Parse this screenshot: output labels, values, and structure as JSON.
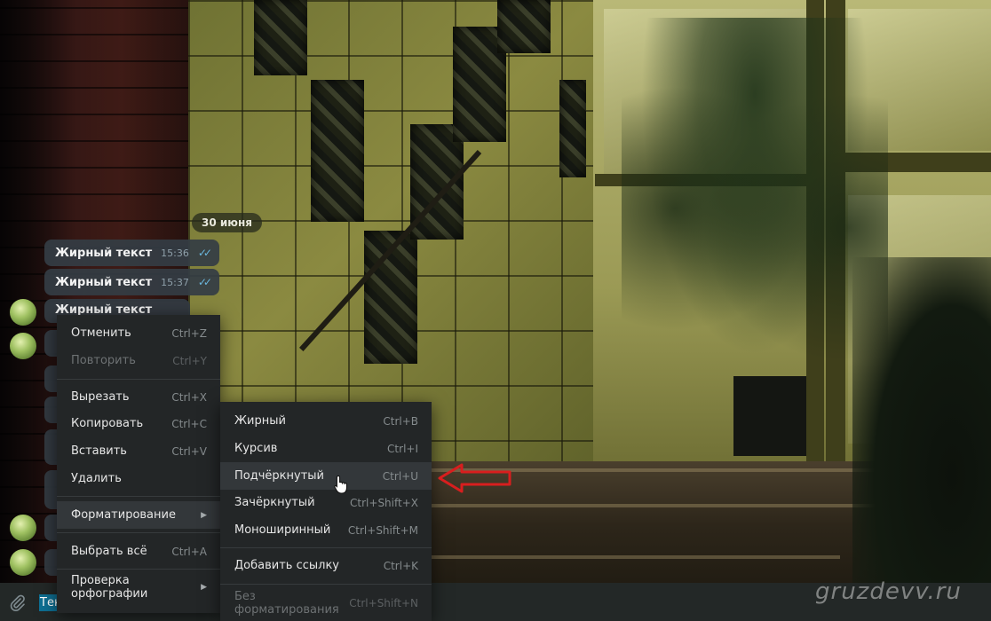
{
  "chat": {
    "date": "30 июня",
    "messages": [
      {
        "text": "Жирный текст",
        "time": "15:36",
        "status": "read"
      },
      {
        "text": "Жирный текст",
        "time": "15:37",
        "status": "read"
      },
      {
        "text": "Жирный текст"
      }
    ]
  },
  "input": {
    "text": "Тек"
  },
  "main_menu": {
    "items": [
      {
        "label": "Отменить",
        "shortcut": "Ctrl+Z"
      },
      {
        "label": "Повторить",
        "shortcut": "Ctrl+Y"
      },
      {
        "label": "Вырезать",
        "shortcut": "Ctrl+X"
      },
      {
        "label": "Копировать",
        "shortcut": "Ctrl+C"
      },
      {
        "label": "Вставить",
        "shortcut": "Ctrl+V"
      },
      {
        "label": "Удалить"
      },
      {
        "label": "Форматирование"
      },
      {
        "label": "Выбрать всё",
        "shortcut": "Ctrl+A"
      },
      {
        "label": "Проверка орфографии"
      }
    ]
  },
  "format_menu": {
    "items": [
      {
        "label": "Жирный",
        "shortcut": "Ctrl+B"
      },
      {
        "label": "Курсив",
        "shortcut": "Ctrl+I"
      },
      {
        "label": "Подчёркнутый",
        "shortcut": "Ctrl+U"
      },
      {
        "label": "Зачёркнутый",
        "shortcut": "Ctrl+Shift+X"
      },
      {
        "label": "Моноширинный",
        "shortcut": "Ctrl+Shift+M"
      },
      {
        "label": "Добавить ссылку",
        "shortcut": "Ctrl+K"
      },
      {
        "label": "Без форматирования",
        "shortcut": "Ctrl+Shift+N"
      }
    ]
  },
  "watermark": "gruzdevv.ru",
  "icons": {
    "attach": "paperclip-icon",
    "read_status": "double-check-icon",
    "submenu": "triangle-right-icon",
    "pointer": "hand-cursor-icon",
    "annotation": "red-arrow-icon"
  },
  "colors": {
    "accent": "#0e6f93",
    "check": "#6bb7de",
    "annotation": "#d81e1e"
  }
}
